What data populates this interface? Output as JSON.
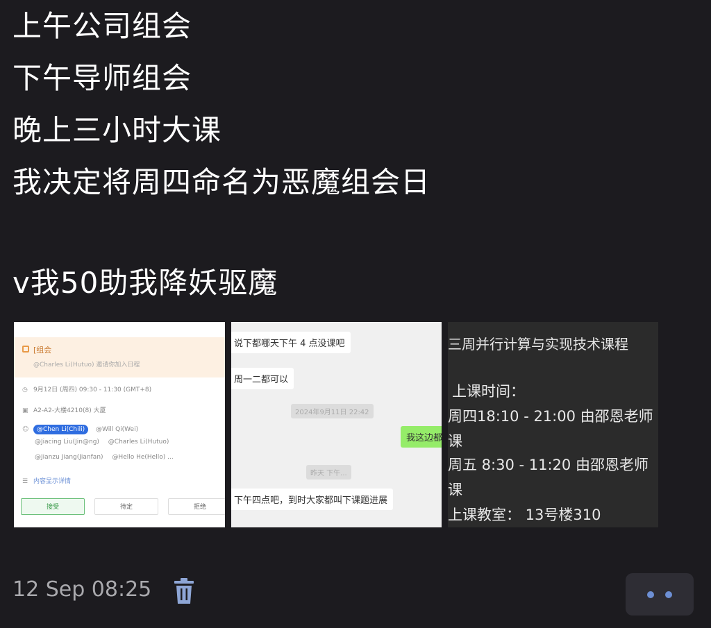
{
  "post": {
    "lines": [
      "上午公司组会",
      "下午导师组会",
      "晚上三小时大课",
      "我决定将周四命名为恶魔组会日",
      "v我50助我降妖驱魔"
    ]
  },
  "images": {
    "calendar": {
      "title": "[组会",
      "organizer": "@Charles Li(Hutuo) 邀请你加入日程",
      "time": "9月12日 (周四) 09:30 - 11:30 (GMT+8)",
      "location": "A2-A2-大楼4210(8) 大厦",
      "attendee_chip": "@Chen Li(Chili)",
      "attendees": [
        "@Will Qi(Wei)",
        "@Jiacing Liu(Jin@ng)",
        "@Charles Li(Hutuo)",
        "@Jianzu Jiang(Jianfan)",
        "@Hello He(Hello) ..."
      ],
      "agenda": "内容显示详情",
      "buttons": [
        "接受",
        "待定",
        "拒绝"
      ]
    },
    "chat": {
      "msg1": "说下都哪天下午 4 点没课吧",
      "msg2": "周一二都可以",
      "time1": "2024年9月11日 22:42",
      "msg3": "我这边都",
      "time2": "昨天 下午...",
      "msg4": "下午四点吧，到时大家都叫下课题进展"
    },
    "course": {
      "title": "三周并行计算与实现技术课程",
      "time_label": "上课时间：",
      "thu": "周四18:10 - 21:00 由邵恩老师",
      "thu_cont": "课",
      "fri": "周五 8:30 - 11:20 由邵恩老师",
      "fri_cont": "课",
      "room": "上课教室： 13号楼310"
    }
  },
  "footer": {
    "timestamp": "12 Sep 08:25"
  },
  "colors": {
    "background": "#1c1b1f",
    "accent": "#6d8fd4"
  }
}
